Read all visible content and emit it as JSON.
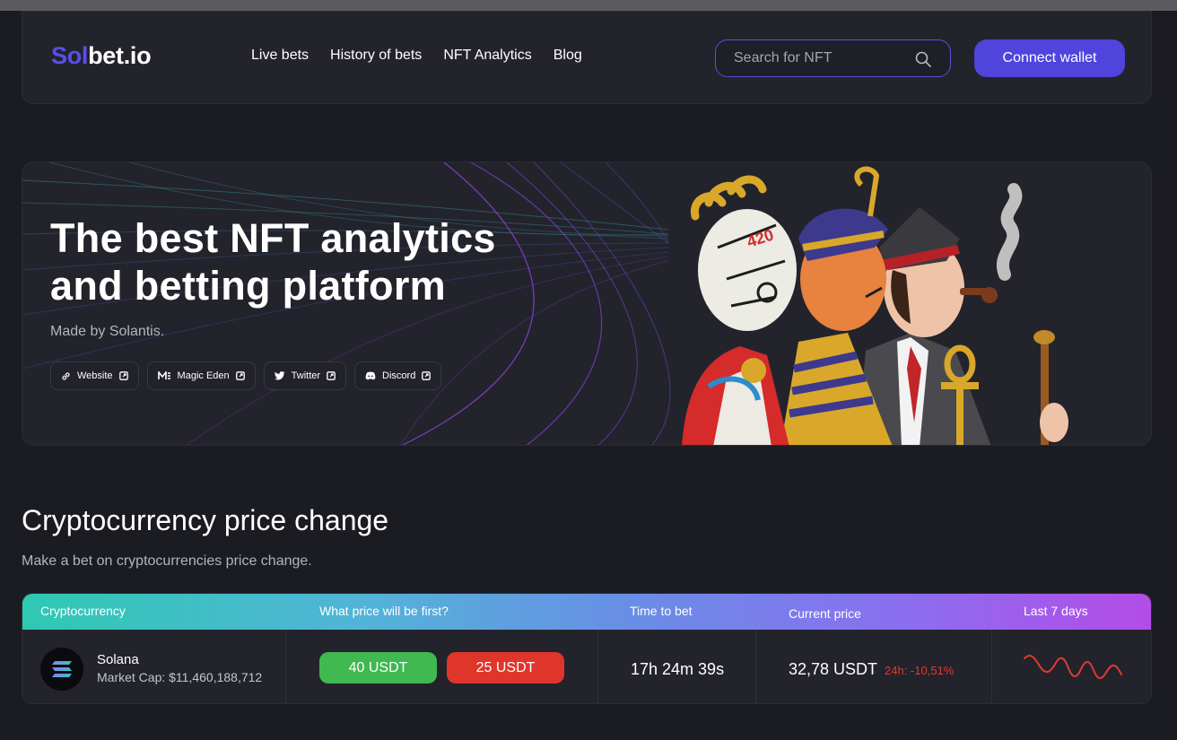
{
  "brand": {
    "logo_part1": "Sol",
    "logo_part2": "bet.io"
  },
  "nav": {
    "links": [
      "Live bets",
      "History of bets",
      "NFT Analytics",
      "Blog"
    ],
    "search_placeholder": "Search for NFT",
    "connect_label": "Connect wallet"
  },
  "hero": {
    "title_line1": "The best NFT analytics",
    "title_line2": "and betting platform",
    "subtitle": "Made by Solantis.",
    "links": [
      {
        "label": "Website",
        "icon": "link-icon"
      },
      {
        "label": "Magic Eden",
        "icon": "magic-eden-icon"
      },
      {
        "label": "Twitter",
        "icon": "twitter-icon"
      },
      {
        "label": "Discord",
        "icon": "discord-icon"
      }
    ]
  },
  "section": {
    "title": "Cryptocurrency price change",
    "subtitle": "Make a bet on cryptocurrencies price change."
  },
  "table": {
    "headers": [
      "Cryptocurrency",
      "What price will be first?",
      "Time to bet",
      "Current price",
      "Last 7 days"
    ],
    "rows": [
      {
        "name": "Solana",
        "market_cap": "Market Cap: $11,460,188,712",
        "bet_up": "40 USDT",
        "bet_down": "25 USDT",
        "time_to_bet": "17h 24m 39s",
        "current_price": "32,78 USDT",
        "change_24h": "24h: -10,51%",
        "spark_color": "#e03a30"
      }
    ]
  },
  "colors": {
    "accent": "#4f44dc",
    "background": "#1b1b22",
    "panel": "#23232c",
    "positive": "#3fb950",
    "negative": "#e0352b"
  }
}
